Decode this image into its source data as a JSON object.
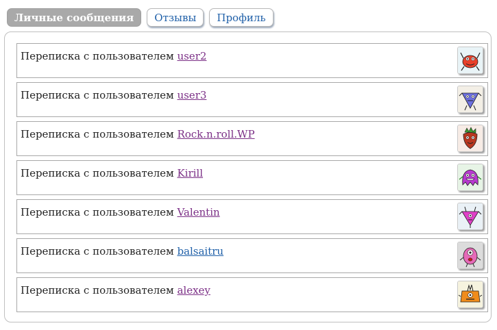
{
  "tabs": [
    {
      "label": "Личные сообщения",
      "active": true
    },
    {
      "label": "Отзывы",
      "active": false
    },
    {
      "label": "Профиль",
      "active": false
    }
  ],
  "conversations": [
    {
      "prefix": "Переписка с пользователем",
      "username": "user2",
      "link_color": "#7b2f86",
      "avatar_icon": "red-monster-avatar-icon"
    },
    {
      "prefix": "Переписка с пользователем",
      "username": "user3",
      "link_color": "#7b2f86",
      "avatar_icon": "blue-triangle-monster-avatar-icon"
    },
    {
      "prefix": "Переписка с пользователем",
      "username": "Rock.n.roll.WP",
      "link_color": "#7b2f86",
      "avatar_icon": "strawberry-monster-avatar-icon"
    },
    {
      "prefix": "Переписка с пользователем",
      "username": "Kirill",
      "link_color": "#7b2f86",
      "avatar_icon": "purple-blob-monster-avatar-icon"
    },
    {
      "prefix": "Переписка с пользователем",
      "username": "Valentin",
      "link_color": "#7b2f86",
      "avatar_icon": "pink-triangle-monster-avatar-icon"
    },
    {
      "prefix": "Переписка с пользователем",
      "username": "balsaitru",
      "link_color": "#1e5fa8",
      "avatar_icon": "pink-cyclops-monster-avatar-icon"
    },
    {
      "prefix": "Переписка с пользователем",
      "username": "alexey",
      "link_color": "#7b2f86",
      "avatar_icon": "orange-monster-avatar-icon"
    }
  ]
}
